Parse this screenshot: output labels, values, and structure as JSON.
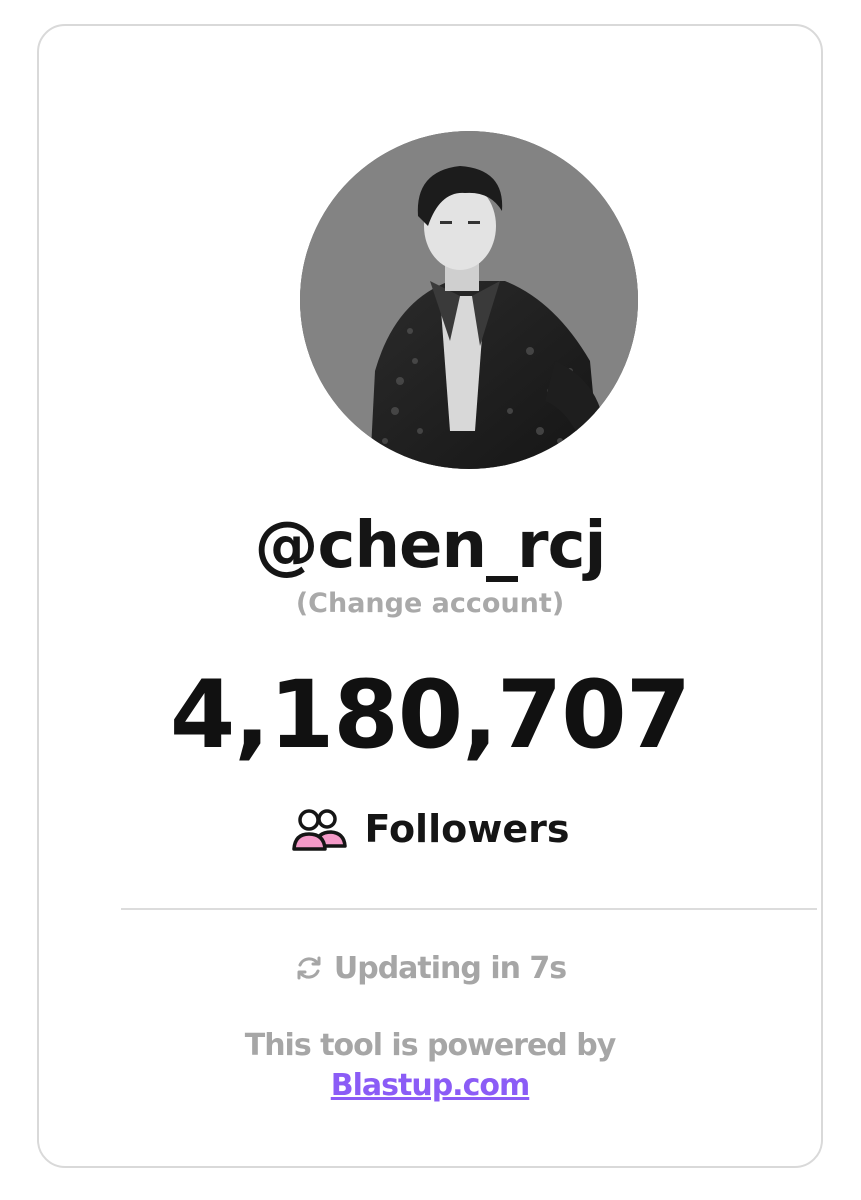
{
  "profile": {
    "username": "@chen_rcj",
    "change_account_label": "(Change account)",
    "avatar_icon": "profile-photo"
  },
  "stats": {
    "follower_count": "4,180,707",
    "followers_label": "Followers",
    "followers_icon": "users-icon"
  },
  "status": {
    "updating_text": "Updating in 7s",
    "refresh_icon": "refresh-icon"
  },
  "footer": {
    "powered_by_text": "This tool is powered by",
    "link_text": "Blastup.com"
  },
  "colors": {
    "text_dark": "#151515",
    "text_muted": "#a6a6a6",
    "link": "#8b5cf6",
    "icon_accent_pink": "#f49ac8",
    "border": "#d9d9d9"
  }
}
